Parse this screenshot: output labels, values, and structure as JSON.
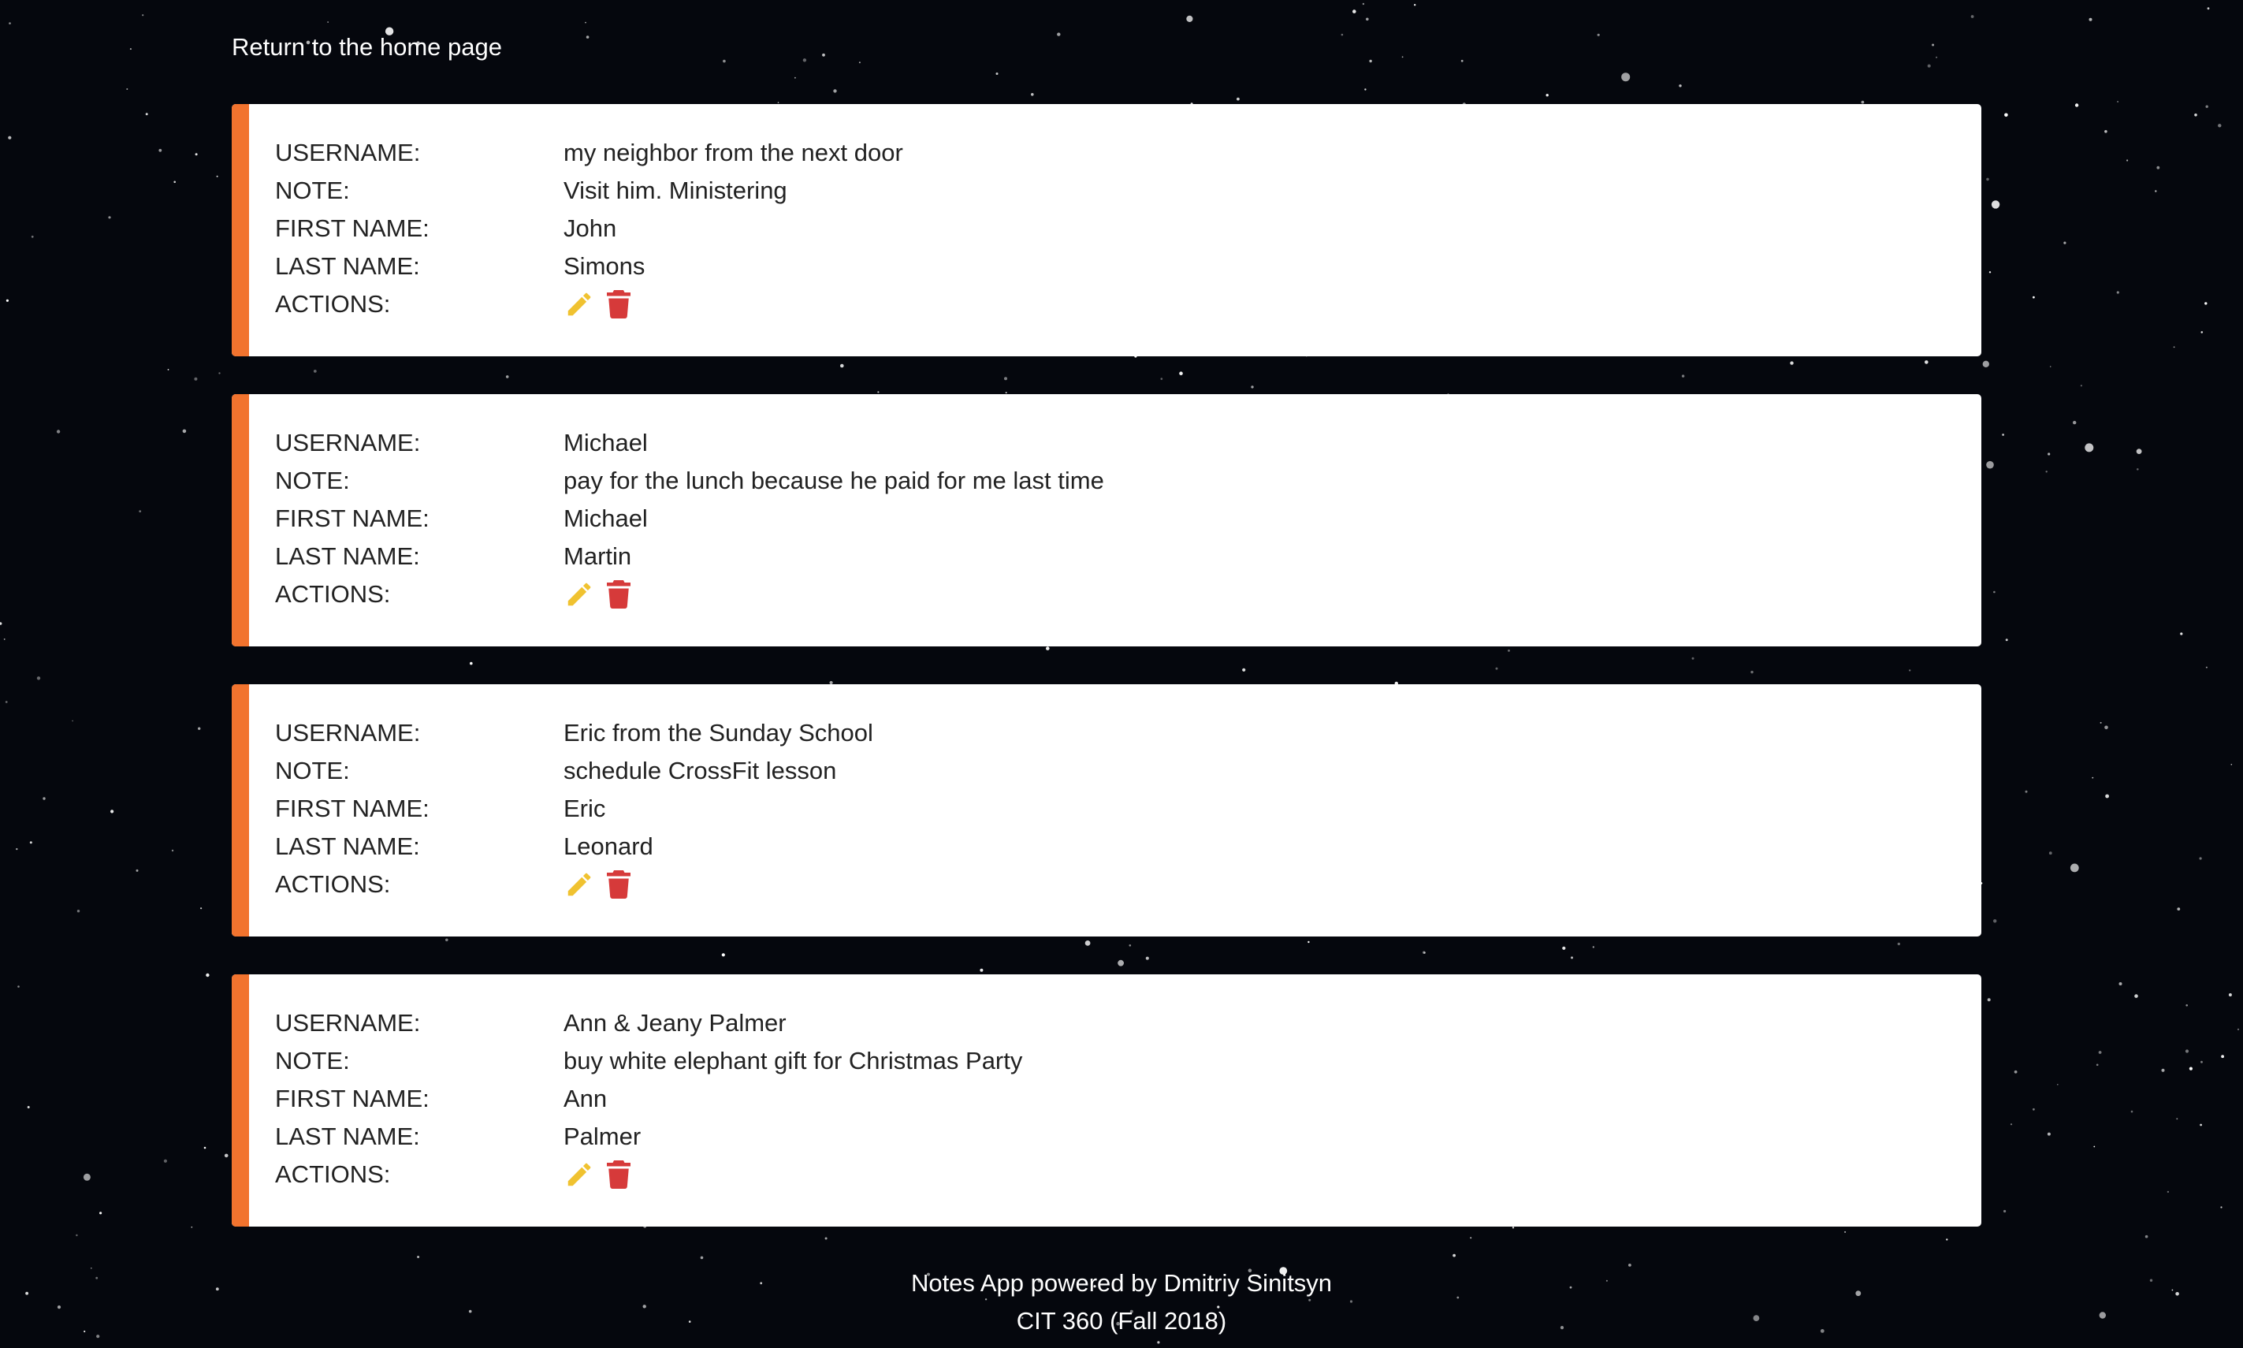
{
  "nav": {
    "home_link": "Return to the home page"
  },
  "labels": {
    "username": "USERNAME:",
    "note": "NOTE:",
    "first_name": "FIRST NAME:",
    "last_name": "LAST NAME:",
    "actions": "ACTIONS:"
  },
  "notes": [
    {
      "username": "my neighbor from the next door",
      "note": "Visit him. Ministering",
      "first_name": "John",
      "last_name": "Simons"
    },
    {
      "username": "Michael",
      "note": "pay for the lunch because he paid for me last time",
      "first_name": "Michael",
      "last_name": "Martin"
    },
    {
      "username": "Eric from the Sunday School",
      "note": "schedule CrossFit lesson",
      "first_name": "Eric",
      "last_name": "Leonard"
    },
    {
      "username": "Ann & Jeany Palmer",
      "note": "buy white elephant gift for Christmas Party",
      "first_name": "Ann",
      "last_name": "Palmer"
    }
  ],
  "icons": {
    "edit": "pencil-icon",
    "delete": "trash-icon"
  },
  "colors": {
    "background": "#05070d",
    "accent": "#f2732e",
    "edit_icon": "#f0c230",
    "delete_icon": "#d63a3a"
  },
  "footer": {
    "line1": "Notes App powered by Dmitriy Sinitsyn",
    "line2": "CIT 360 (Fall 2018)"
  }
}
